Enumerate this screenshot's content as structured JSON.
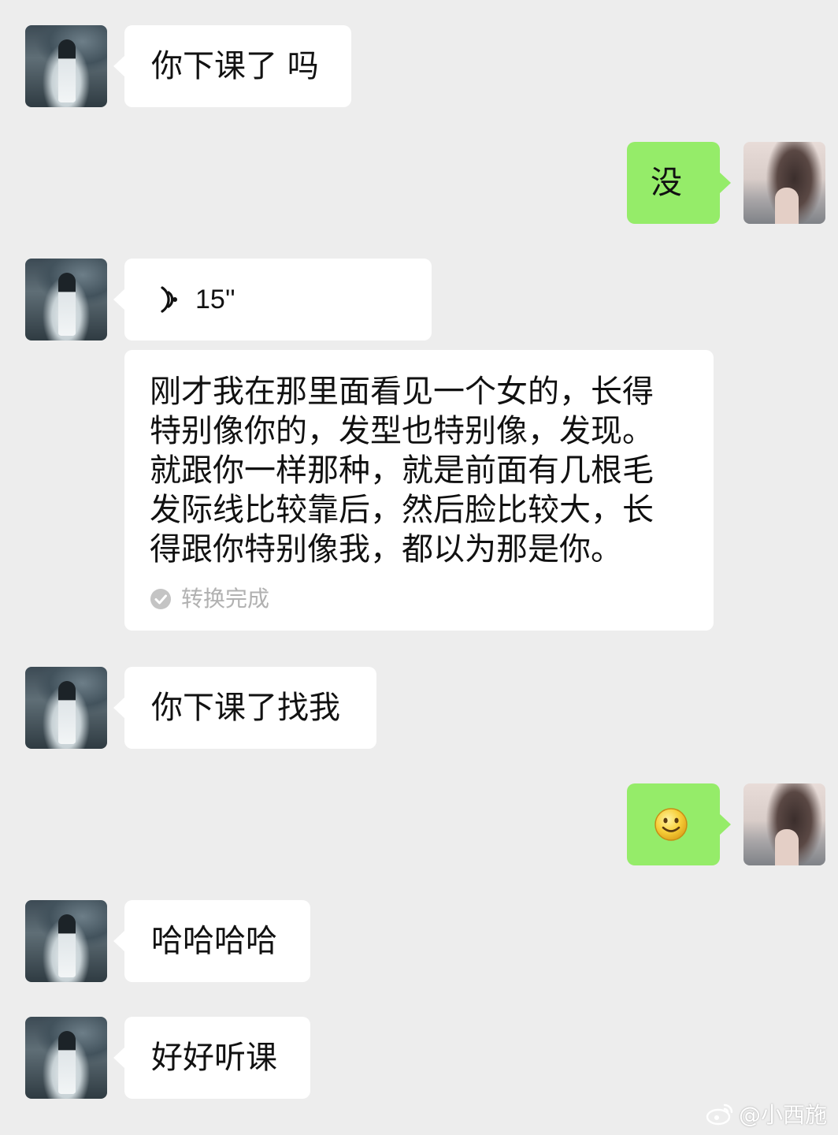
{
  "chat": {
    "messages": [
      {
        "from": "contact",
        "kind": "text",
        "text": "你下课了 吗"
      },
      {
        "from": "self",
        "kind": "text",
        "text": "没"
      },
      {
        "from": "contact",
        "kind": "voice",
        "duration": "15''",
        "transcript": "刚才我在那里面看见一个女的，长得\n特别像你的，发型也特别像，发现。\n就跟你一样那种，就是前面有几根毛\n发际线比较靠后，然后脸比较大，长\n得跟你特别像我，都以为那是你。",
        "transcript_status": "转换完成"
      },
      {
        "from": "contact",
        "kind": "text",
        "text": "你下课了找我"
      },
      {
        "from": "self",
        "kind": "emoji",
        "emoji": "smiley-face"
      },
      {
        "from": "contact",
        "kind": "text",
        "text": "哈哈哈哈"
      },
      {
        "from": "contact",
        "kind": "text",
        "text": "好好听课"
      }
    ]
  },
  "watermark": {
    "text": "@小西施",
    "icon": "weibo-icon"
  },
  "colors": {
    "background": "#ededed",
    "incoming_bubble": "#ffffff",
    "outgoing_bubble": "#95ec69",
    "status_text": "#b1b1b1"
  }
}
